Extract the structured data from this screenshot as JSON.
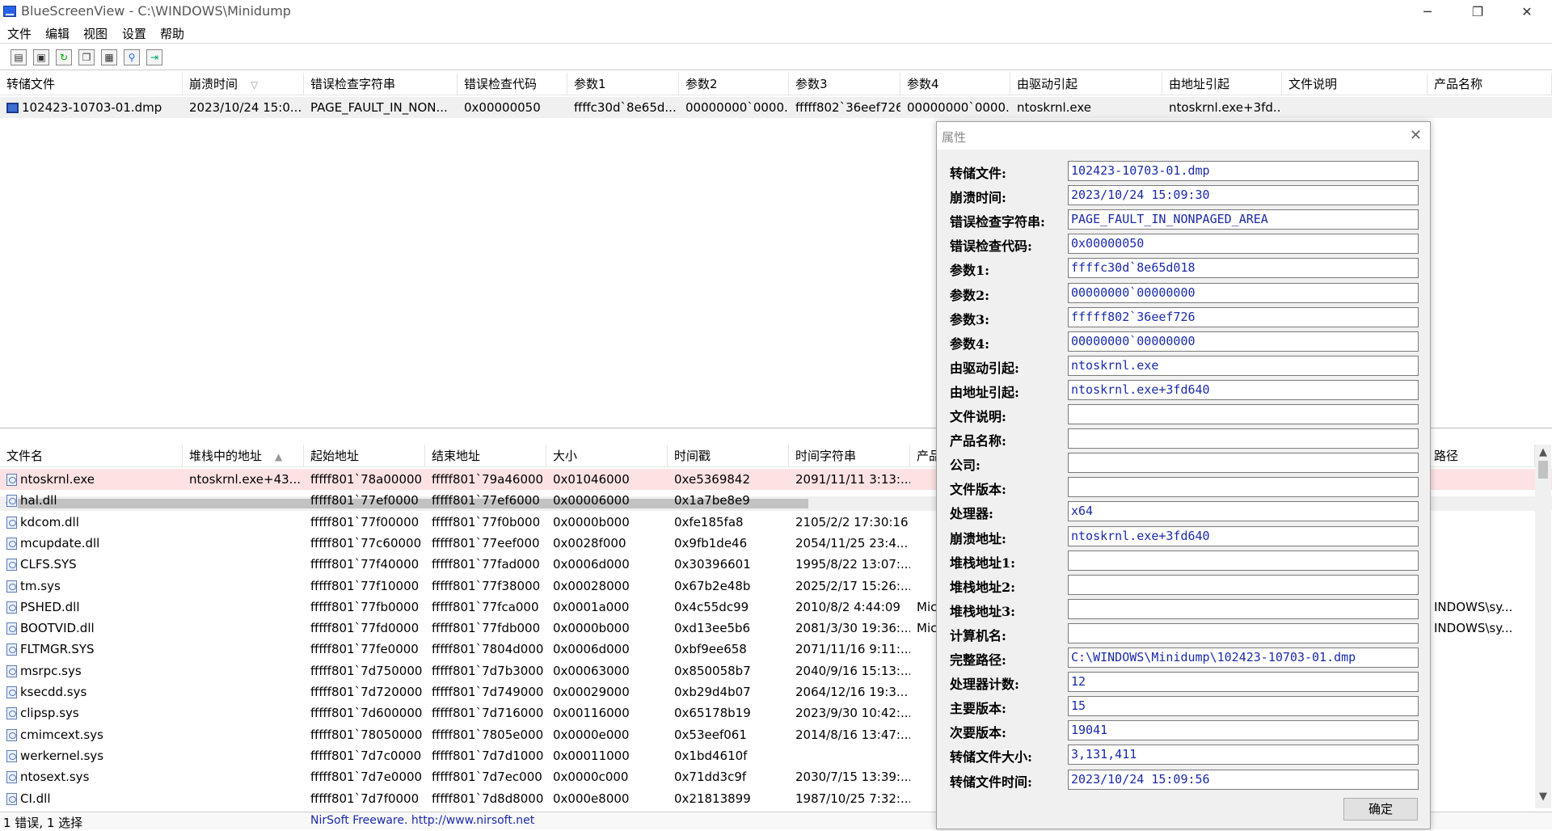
{
  "window": {
    "title": "BlueScreenView  -  C:\\WINDOWS\\Minidump",
    "minimize_icon": "─",
    "restore_icon": "❐",
    "close_icon": "✕"
  },
  "menu": [
    "文件",
    "编辑",
    "视图",
    "设置",
    "帮助"
  ],
  "toolbar": {
    "buttons": [
      "properties-icon",
      "save-icon",
      "refresh-icon",
      "copy-icon",
      "options-icon",
      "find-icon",
      "exit-icon"
    ]
  },
  "dump_list": {
    "columns": [
      "转储文件",
      "崩溃时间",
      "错误检查字符串",
      "错误检查代码",
      "参数1",
      "参数2",
      "参数3",
      "参数4",
      "由驱动引起",
      "由地址引起",
      "文件说明",
      "产品名称"
    ],
    "sort_indicator": "▽",
    "rows": [
      [
        "102423-10703-01.dmp",
        "2023/10/24 15:0...",
        "PAGE_FAULT_IN_NON...",
        "0x00000050",
        "ffffc30d`8e65d...",
        "00000000`0000...",
        "fffff802`36eef726",
        "00000000`0000...",
        "ntoskrnl.exe",
        "ntoskrnl.exe+3fd...",
        "",
        ""
      ]
    ]
  },
  "module_list": {
    "columns": [
      "文件名",
      "堆栈中的地址",
      "起始地址",
      "结束地址",
      "大小",
      "时间戳",
      "时间字符串",
      "产品",
      "",
      "",
      "路径"
    ],
    "sort_indicator": "▲",
    "rows": [
      [
        "ntoskrnl.exe",
        "ntoskrnl.exe+43...",
        "fffff801`78a00000",
        "fffff801`79a46000",
        "0x01046000",
        "0xe5369842",
        "2091/11/11 3:13:...",
        "",
        ""
      ],
      [
        "hal.dll",
        "",
        "fffff801`77ef0000",
        "fffff801`77ef6000",
        "0x00006000",
        "0x1a7be8e9",
        "",
        "",
        ""
      ],
      [
        "kdcom.dll",
        "",
        "fffff801`77f00000",
        "fffff801`77f0b000",
        "0x0000b000",
        "0xfe185fa8",
        "2105/2/2 17:30:16",
        "",
        ""
      ],
      [
        "mcupdate.dll",
        "",
        "fffff801`77c60000",
        "fffff801`77eef000",
        "0x0028f000",
        "0x9fb1de46",
        "2054/11/25 23:4...",
        "",
        ""
      ],
      [
        "CLFS.SYS",
        "",
        "fffff801`77f40000",
        "fffff801`77fad000",
        "0x0006d000",
        "0x30396601",
        "1995/8/22 13:07:...",
        "",
        ""
      ],
      [
        "tm.sys",
        "",
        "fffff801`77f10000",
        "fffff801`77f38000",
        "0x00028000",
        "0x67b2e48b",
        "2025/2/17 15:26:...",
        "",
        ""
      ],
      [
        "PSHED.dll",
        "",
        "fffff801`77fb0000",
        "fffff801`77fca000",
        "0x0001a000",
        "0x4c55dc99",
        "2010/8/2 4:44:09",
        "Mic",
        "INDOWS\\sy..."
      ],
      [
        "BOOTVID.dll",
        "",
        "fffff801`77fd0000",
        "fffff801`77fdb000",
        "0x0000b000",
        "0xd13ee5b6",
        "2081/3/30 19:36:...",
        "Mic",
        "INDOWS\\sy..."
      ],
      [
        "FLTMGR.SYS",
        "",
        "fffff801`77fe0000",
        "fffff801`7804d000",
        "0x0006d000",
        "0xbf9ee658",
        "2071/11/16 9:11:...",
        "",
        ""
      ],
      [
        "msrpc.sys",
        "",
        "fffff801`7d750000",
        "fffff801`7d7b3000",
        "0x00063000",
        "0x850058b7",
        "2040/9/16 15:13:...",
        "",
        ""
      ],
      [
        "ksecdd.sys",
        "",
        "fffff801`7d720000",
        "fffff801`7d749000",
        "0x00029000",
        "0xb29d4b07",
        "2064/12/16 19:3...",
        "",
        ""
      ],
      [
        "clipsp.sys",
        "",
        "fffff801`7d600000",
        "fffff801`7d716000",
        "0x00116000",
        "0x65178b19",
        "2023/9/30 10:42:...",
        "",
        ""
      ],
      [
        "cmimcext.sys",
        "",
        "fffff801`78050000",
        "fffff801`7805e000",
        "0x0000e000",
        "0x53eef061",
        "2014/8/16 13:47:...",
        "",
        ""
      ],
      [
        "werkernel.sys",
        "",
        "fffff801`7d7c0000",
        "fffff801`7d7d1000",
        "0x00011000",
        "0x1bd4610f",
        "",
        "",
        ""
      ],
      [
        "ntosext.sys",
        "",
        "fffff801`7d7e0000",
        "fffff801`7d7ec000",
        "0x0000c000",
        "0x71dd3c9f",
        "2030/7/15 13:39:...",
        "",
        ""
      ],
      [
        "CI.dll",
        "",
        "fffff801`7d7f0000",
        "fffff801`7d8d8000",
        "0x000e8000",
        "0x21813899",
        "1987/10/25 7:32:...",
        "",
        ""
      ]
    ]
  },
  "status": {
    "left": "1 错误, 1 选择",
    "center": "NirSoft Freeware.  http://www.nirsoft.net"
  },
  "dialog": {
    "title": "属性",
    "ok": "确定",
    "props": [
      {
        "label": "转储文件:",
        "value": "102423-10703-01.dmp"
      },
      {
        "label": "崩溃时间:",
        "value": "2023/10/24 15:09:30"
      },
      {
        "label": "错误检查字符串:",
        "value": "PAGE_FAULT_IN_NONPAGED_AREA"
      },
      {
        "label": "错误检查代码:",
        "value": "0x00000050"
      },
      {
        "label": "参数1:",
        "value": "ffffc30d`8e65d018"
      },
      {
        "label": "参数2:",
        "value": "00000000`00000000"
      },
      {
        "label": "参数3:",
        "value": "fffff802`36eef726"
      },
      {
        "label": "参数4:",
        "value": "00000000`00000000"
      },
      {
        "label": "由驱动引起:",
        "value": "ntoskrnl.exe"
      },
      {
        "label": "由地址引起:",
        "value": "ntoskrnl.exe+3fd640"
      },
      {
        "label": "文件说明:",
        "value": ""
      },
      {
        "label": "产品名称:",
        "value": ""
      },
      {
        "label": "公司:",
        "value": ""
      },
      {
        "label": "文件版本:",
        "value": ""
      },
      {
        "label": "处理器:",
        "value": "x64"
      },
      {
        "label": "崩溃地址:",
        "value": "ntoskrnl.exe+3fd640"
      },
      {
        "label": "堆栈地址1:",
        "value": ""
      },
      {
        "label": "堆栈地址2:",
        "value": ""
      },
      {
        "label": "堆栈地址3:",
        "value": ""
      },
      {
        "label": "计算机名:",
        "value": ""
      },
      {
        "label": "完整路径:",
        "value": "C:\\WINDOWS\\Minidump\\102423-10703-01.dmp"
      },
      {
        "label": "处理器计数:",
        "value": "12"
      },
      {
        "label": "主要版本:",
        "value": "15"
      },
      {
        "label": "次要版本:",
        "value": "19041"
      },
      {
        "label": "转储文件大小:",
        "value": "3,131,411"
      },
      {
        "label": "转储文件时间:",
        "value": "2023/10/24 15:09:56"
      }
    ]
  },
  "colors": {
    "selected_row": "#fde2e4",
    "top_selected": "#f0f0f0",
    "field_text": "#1a2aa8",
    "link": "#1a2aa8"
  }
}
